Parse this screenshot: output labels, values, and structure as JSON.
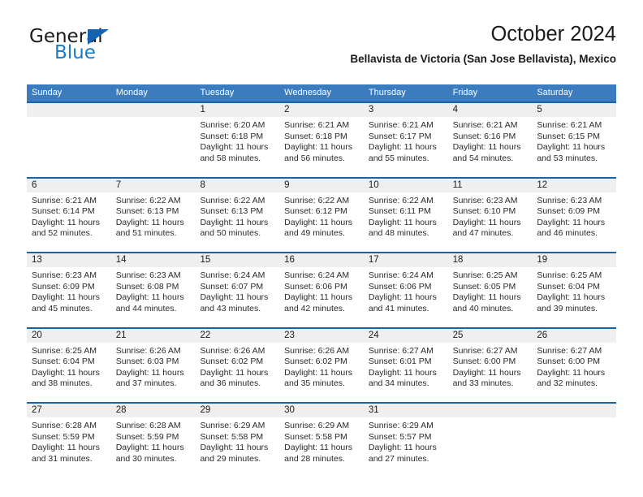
{
  "brand": {
    "name_dark": "General",
    "name_blue": "Blue",
    "accent_blue": "#1a7bc6",
    "triangle_blue": "#1263b0"
  },
  "header": {
    "title": "October 2024",
    "subtitle": "Bellavista de Victoria (San Jose Bellavista), Mexico"
  },
  "colors": {
    "header_row_bg": "#3a7cbe",
    "week_divider": "#1764ab",
    "daynum_bg": "#efefef"
  },
  "weekdays": [
    "Sunday",
    "Monday",
    "Tuesday",
    "Wednesday",
    "Thursday",
    "Friday",
    "Saturday"
  ],
  "weeks": [
    [
      {
        "day": "",
        "sunrise": "",
        "sunset": "",
        "daylight1": "",
        "daylight2": ""
      },
      {
        "day": "",
        "sunrise": "",
        "sunset": "",
        "daylight1": "",
        "daylight2": ""
      },
      {
        "day": "1",
        "sunrise": "Sunrise: 6:20 AM",
        "sunset": "Sunset: 6:18 PM",
        "daylight1": "Daylight: 11 hours",
        "daylight2": "and 58 minutes."
      },
      {
        "day": "2",
        "sunrise": "Sunrise: 6:21 AM",
        "sunset": "Sunset: 6:18 PM",
        "daylight1": "Daylight: 11 hours",
        "daylight2": "and 56 minutes."
      },
      {
        "day": "3",
        "sunrise": "Sunrise: 6:21 AM",
        "sunset": "Sunset: 6:17 PM",
        "daylight1": "Daylight: 11 hours",
        "daylight2": "and 55 minutes."
      },
      {
        "day": "4",
        "sunrise": "Sunrise: 6:21 AM",
        "sunset": "Sunset: 6:16 PM",
        "daylight1": "Daylight: 11 hours",
        "daylight2": "and 54 minutes."
      },
      {
        "day": "5",
        "sunrise": "Sunrise: 6:21 AM",
        "sunset": "Sunset: 6:15 PM",
        "daylight1": "Daylight: 11 hours",
        "daylight2": "and 53 minutes."
      }
    ],
    [
      {
        "day": "6",
        "sunrise": "Sunrise: 6:21 AM",
        "sunset": "Sunset: 6:14 PM",
        "daylight1": "Daylight: 11 hours",
        "daylight2": "and 52 minutes."
      },
      {
        "day": "7",
        "sunrise": "Sunrise: 6:22 AM",
        "sunset": "Sunset: 6:13 PM",
        "daylight1": "Daylight: 11 hours",
        "daylight2": "and 51 minutes."
      },
      {
        "day": "8",
        "sunrise": "Sunrise: 6:22 AM",
        "sunset": "Sunset: 6:13 PM",
        "daylight1": "Daylight: 11 hours",
        "daylight2": "and 50 minutes."
      },
      {
        "day": "9",
        "sunrise": "Sunrise: 6:22 AM",
        "sunset": "Sunset: 6:12 PM",
        "daylight1": "Daylight: 11 hours",
        "daylight2": "and 49 minutes."
      },
      {
        "day": "10",
        "sunrise": "Sunrise: 6:22 AM",
        "sunset": "Sunset: 6:11 PM",
        "daylight1": "Daylight: 11 hours",
        "daylight2": "and 48 minutes."
      },
      {
        "day": "11",
        "sunrise": "Sunrise: 6:23 AM",
        "sunset": "Sunset: 6:10 PM",
        "daylight1": "Daylight: 11 hours",
        "daylight2": "and 47 minutes."
      },
      {
        "day": "12",
        "sunrise": "Sunrise: 6:23 AM",
        "sunset": "Sunset: 6:09 PM",
        "daylight1": "Daylight: 11 hours",
        "daylight2": "and 46 minutes."
      }
    ],
    [
      {
        "day": "13",
        "sunrise": "Sunrise: 6:23 AM",
        "sunset": "Sunset: 6:09 PM",
        "daylight1": "Daylight: 11 hours",
        "daylight2": "and 45 minutes."
      },
      {
        "day": "14",
        "sunrise": "Sunrise: 6:23 AM",
        "sunset": "Sunset: 6:08 PM",
        "daylight1": "Daylight: 11 hours",
        "daylight2": "and 44 minutes."
      },
      {
        "day": "15",
        "sunrise": "Sunrise: 6:24 AM",
        "sunset": "Sunset: 6:07 PM",
        "daylight1": "Daylight: 11 hours",
        "daylight2": "and 43 minutes."
      },
      {
        "day": "16",
        "sunrise": "Sunrise: 6:24 AM",
        "sunset": "Sunset: 6:06 PM",
        "daylight1": "Daylight: 11 hours",
        "daylight2": "and 42 minutes."
      },
      {
        "day": "17",
        "sunrise": "Sunrise: 6:24 AM",
        "sunset": "Sunset: 6:06 PM",
        "daylight1": "Daylight: 11 hours",
        "daylight2": "and 41 minutes."
      },
      {
        "day": "18",
        "sunrise": "Sunrise: 6:25 AM",
        "sunset": "Sunset: 6:05 PM",
        "daylight1": "Daylight: 11 hours",
        "daylight2": "and 40 minutes."
      },
      {
        "day": "19",
        "sunrise": "Sunrise: 6:25 AM",
        "sunset": "Sunset: 6:04 PM",
        "daylight1": "Daylight: 11 hours",
        "daylight2": "and 39 minutes."
      }
    ],
    [
      {
        "day": "20",
        "sunrise": "Sunrise: 6:25 AM",
        "sunset": "Sunset: 6:04 PM",
        "daylight1": "Daylight: 11 hours",
        "daylight2": "and 38 minutes."
      },
      {
        "day": "21",
        "sunrise": "Sunrise: 6:26 AM",
        "sunset": "Sunset: 6:03 PM",
        "daylight1": "Daylight: 11 hours",
        "daylight2": "and 37 minutes."
      },
      {
        "day": "22",
        "sunrise": "Sunrise: 6:26 AM",
        "sunset": "Sunset: 6:02 PM",
        "daylight1": "Daylight: 11 hours",
        "daylight2": "and 36 minutes."
      },
      {
        "day": "23",
        "sunrise": "Sunrise: 6:26 AM",
        "sunset": "Sunset: 6:02 PM",
        "daylight1": "Daylight: 11 hours",
        "daylight2": "and 35 minutes."
      },
      {
        "day": "24",
        "sunrise": "Sunrise: 6:27 AM",
        "sunset": "Sunset: 6:01 PM",
        "daylight1": "Daylight: 11 hours",
        "daylight2": "and 34 minutes."
      },
      {
        "day": "25",
        "sunrise": "Sunrise: 6:27 AM",
        "sunset": "Sunset: 6:00 PM",
        "daylight1": "Daylight: 11 hours",
        "daylight2": "and 33 minutes."
      },
      {
        "day": "26",
        "sunrise": "Sunrise: 6:27 AM",
        "sunset": "Sunset: 6:00 PM",
        "daylight1": "Daylight: 11 hours",
        "daylight2": "and 32 minutes."
      }
    ],
    [
      {
        "day": "27",
        "sunrise": "Sunrise: 6:28 AM",
        "sunset": "Sunset: 5:59 PM",
        "daylight1": "Daylight: 11 hours",
        "daylight2": "and 31 minutes."
      },
      {
        "day": "28",
        "sunrise": "Sunrise: 6:28 AM",
        "sunset": "Sunset: 5:59 PM",
        "daylight1": "Daylight: 11 hours",
        "daylight2": "and 30 minutes."
      },
      {
        "day": "29",
        "sunrise": "Sunrise: 6:29 AM",
        "sunset": "Sunset: 5:58 PM",
        "daylight1": "Daylight: 11 hours",
        "daylight2": "and 29 minutes."
      },
      {
        "day": "30",
        "sunrise": "Sunrise: 6:29 AM",
        "sunset": "Sunset: 5:58 PM",
        "daylight1": "Daylight: 11 hours",
        "daylight2": "and 28 minutes."
      },
      {
        "day": "31",
        "sunrise": "Sunrise: 6:29 AM",
        "sunset": "Sunset: 5:57 PM",
        "daylight1": "Daylight: 11 hours",
        "daylight2": "and 27 minutes."
      },
      {
        "day": "",
        "sunrise": "",
        "sunset": "",
        "daylight1": "",
        "daylight2": ""
      },
      {
        "day": "",
        "sunrise": "",
        "sunset": "",
        "daylight1": "",
        "daylight2": ""
      }
    ]
  ]
}
